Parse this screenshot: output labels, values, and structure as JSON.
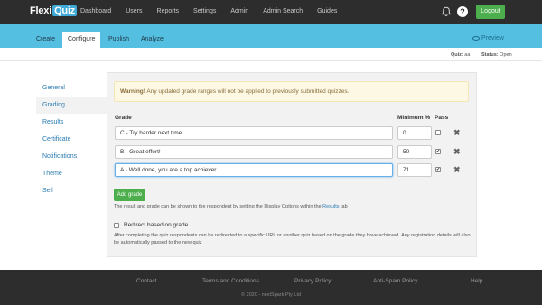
{
  "app": {
    "logo_main": "Flexi",
    "logo_badge": "Quiz"
  },
  "topnav": {
    "items": [
      "Dashboard",
      "Users",
      "Reports",
      "Settings",
      "Admin",
      "Admin Search",
      "Guides"
    ],
    "logout_label": "Logout"
  },
  "subnav": {
    "tabs": [
      "Create",
      "Configure",
      "Publish",
      "Analyze"
    ],
    "active_tab": "Configure",
    "preview_label": "Preview"
  },
  "status": {
    "quiz_label": "Quiz:",
    "quiz_value": "aa",
    "status_label": "Status:",
    "status_value": "Open"
  },
  "sidebar": {
    "items": [
      "General",
      "Grading",
      "Results",
      "Certificate",
      "Notifications",
      "Theme",
      "Sell"
    ],
    "active": "Grading"
  },
  "warning": {
    "strong": "Warning!",
    "text": "Any updated grade ranges will not be applied to previously submitted quizzes."
  },
  "table": {
    "headers": {
      "grade": "Grade",
      "minimum": "Minimum %",
      "pass": "Pass"
    },
    "rows": [
      {
        "grade": "C - Try harder next time",
        "minimum": "0",
        "pass": false
      },
      {
        "grade": "B - Great effort!",
        "minimum": "50",
        "pass": true
      },
      {
        "grade": "A - Well done, you are a top achiever.",
        "minimum": "71",
        "pass": true
      }
    ]
  },
  "add_grade_label": "Add grade",
  "help_text": {
    "before": "The result and grade can be shown to the respondent by setting the Display Options within the ",
    "link": "Results",
    "after": " tab"
  },
  "redirect": {
    "label": "Redirect based on grade",
    "description": "After completing the quiz respondents can be redirected to a specific URL or another quiz based on the grade they have achieved. Any registration details will also be automatically passed to the new quiz"
  },
  "footer": {
    "links": [
      "Contact",
      "Terms and Conditions",
      "Privacy Policy",
      "Anti-Spam Policy",
      "Help"
    ],
    "copyright": "© 2020 - nextSpark Pty Ltd"
  },
  "colors": {
    "topnav_bg": "#2d2d2d",
    "subnav_bg": "#54bfe0",
    "accent_green": "#4cae4c",
    "link_blue": "#2a7bb0",
    "warning_bg": "#fcf8e3"
  }
}
